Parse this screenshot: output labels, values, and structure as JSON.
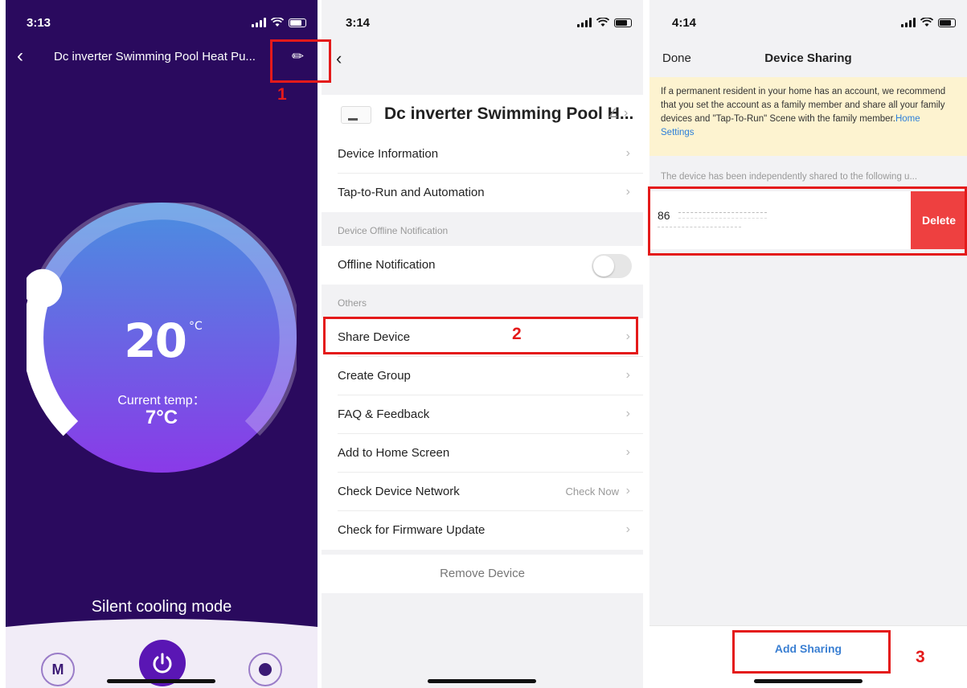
{
  "colors": {
    "p1_background": "#2a0a5e",
    "dial_gradient_top": "#4a8fe0",
    "dial_gradient_bottom": "#8a3ae8",
    "accent_purple": "#5a16b4",
    "link_blue": "#3a7fd2",
    "delete_red": "#ee4040",
    "annotation_red": "#e41a1a",
    "notice_yellow": "#fdf3d0"
  },
  "panel1": {
    "status_time": "3:13",
    "back_icon": "chevron-left-icon",
    "title": "Dc inverter Swimming Pool Heat Pu...",
    "edit_icon": "pencil-icon",
    "set_temp": "20",
    "set_temp_unit": "°C",
    "current_label": "Current temp：",
    "current_temp": "7°C",
    "mode": "Silent cooling mode",
    "mode_button": "M",
    "power_icon": "power-icon",
    "timer_icon": "timer-icon",
    "dial_level": 0.25
  },
  "panel2": {
    "status_time": "3:14",
    "back_icon": "chevron-left-icon",
    "device_name": "Dc inverter Swimming Pool H...",
    "edit_icon": "pencil-icon",
    "rows": [
      {
        "label": "Device Information"
      },
      {
        "label": "Tap-to-Run and Automation"
      },
      {
        "label": "Offline Notification"
      },
      {
        "label": "Share Device"
      },
      {
        "label": "Create Group"
      },
      {
        "label": "FAQ & Feedback"
      },
      {
        "label": "Add to Home Screen"
      },
      {
        "label": "Check Device Network",
        "value": "Check Now"
      },
      {
        "label": "Check for Firmware Update"
      }
    ],
    "section_offline": "Device Offline Notification",
    "section_others": "Others",
    "remove": "Remove Device"
  },
  "panel3": {
    "status_time": "4:14",
    "done": "Done",
    "title": "Device Sharing",
    "notice_text": "If a permanent resident in your home has an account, we recommend that you set the account as a family member and share all your family devices and \"Tap-To-Run\" Scene with the family member.",
    "notice_link": "Home Settings",
    "shared_header": "The device has been independently shared to the following u...",
    "share_number": "86",
    "delete": "Delete",
    "add_sharing": "Add Sharing"
  },
  "annotations": {
    "step1": "1",
    "step2": "2",
    "step3": "3"
  }
}
